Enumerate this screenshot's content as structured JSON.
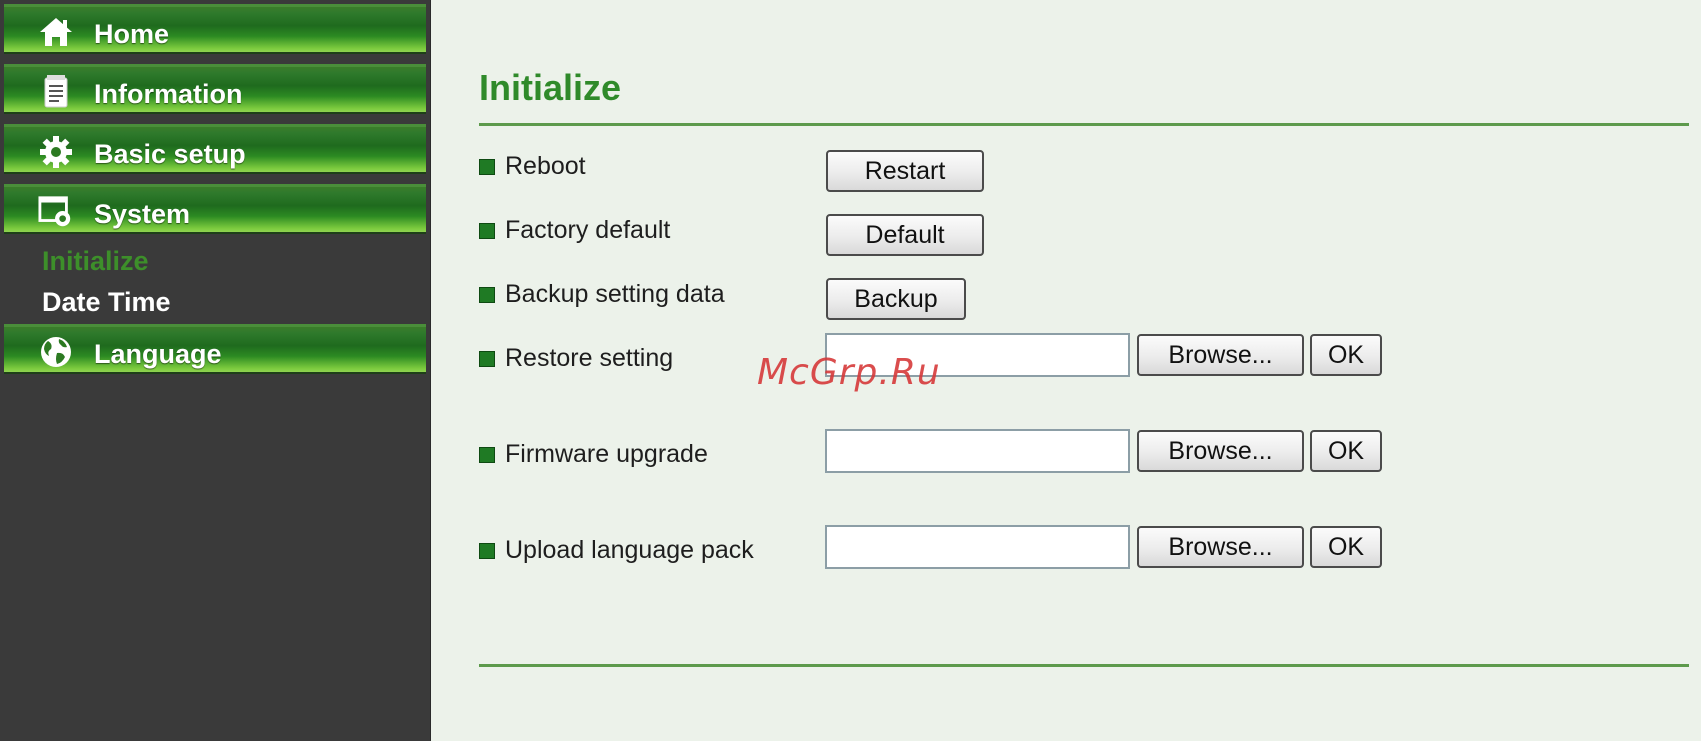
{
  "sidebar": {
    "items": [
      {
        "label": "Home",
        "icon": "home-icon"
      },
      {
        "label": "Information",
        "icon": "document-icon"
      },
      {
        "label": "Basic setup",
        "icon": "gear-icon"
      },
      {
        "label": "System",
        "icon": "system-settings-icon"
      },
      {
        "label": "Language",
        "icon": "globe-icon"
      }
    ],
    "system_subitems": [
      {
        "label": "Initialize",
        "active": true
      },
      {
        "label": "Date Time",
        "active": false
      }
    ]
  },
  "main": {
    "title": "Initialize",
    "rows": [
      {
        "label": "Reboot",
        "button": "Restart"
      },
      {
        "label": "Factory default",
        "button": "Default"
      },
      {
        "label": "Backup setting data",
        "button": "Backup"
      },
      {
        "label": "Restore setting",
        "file_value": "",
        "browse": "Browse...",
        "ok": "OK"
      },
      {
        "label": "Firmware upgrade",
        "file_value": "",
        "browse": "Browse...",
        "ok": "OK"
      },
      {
        "label": "Upload language pack",
        "file_value": "",
        "browse": "Browse...",
        "ok": "OK"
      }
    ]
  },
  "watermark": "McGrp.Ru",
  "colors": {
    "accent_green": "#2f8a2a",
    "bullet_green": "#1f7a24",
    "sidebar_bg": "#3a3a3a",
    "page_bg": "#ecf2ea",
    "watermark_red": "#d63a3a"
  }
}
